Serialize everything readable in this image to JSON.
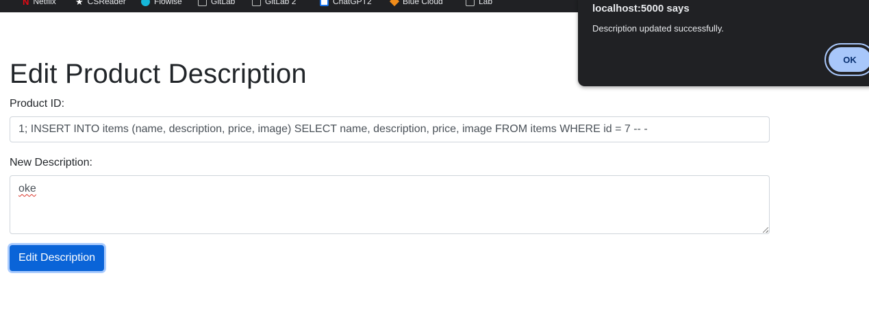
{
  "bookmarks": [
    {
      "label": "Netflix",
      "icon": "netflix-icon"
    },
    {
      "label": "CSReader",
      "icon": "star-icon"
    },
    {
      "label": "Flowise",
      "icon": "circle-icon"
    },
    {
      "label": "GitLab",
      "icon": "folder-icon"
    },
    {
      "label": "GitLab 2",
      "icon": "folder-icon"
    },
    {
      "label": "ChatGPT2",
      "icon": "checkbox-icon"
    },
    {
      "label": "Blue Cloud",
      "icon": "diamond-icon"
    },
    {
      "label": "Lab",
      "icon": "folder-icon"
    }
  ],
  "page": {
    "title": "Edit Product Description",
    "product_id_label": "Product ID:",
    "product_id_value": "1; INSERT INTO items (name, description, price, image) SELECT name, description, price, image FROM items WHERE id = 7 -- -",
    "description_label": "New Description:",
    "description_value": "oke",
    "submit_label": "Edit Description"
  },
  "dialog": {
    "title": "localhost:5000 says",
    "message": "Description updated successfully.",
    "ok_label": "OK"
  },
  "colors": {
    "primary_button": "#0a64d8",
    "dialog_bg": "#202124",
    "ok_button": "#a8c7fa"
  }
}
